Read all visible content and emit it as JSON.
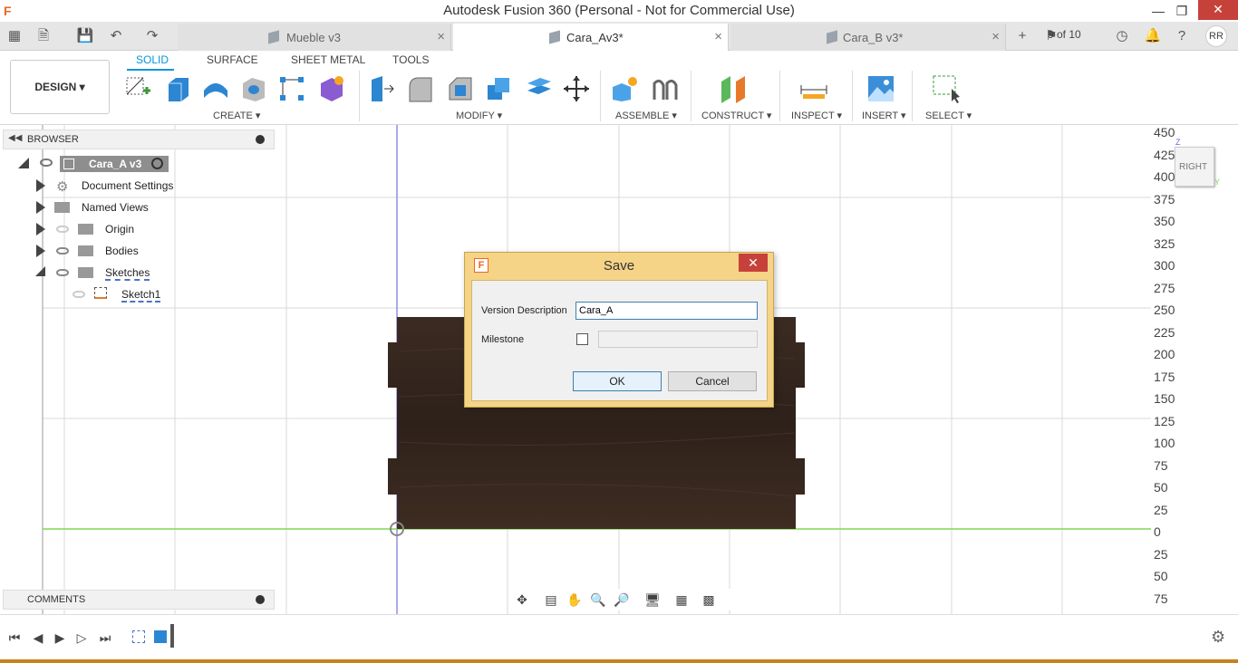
{
  "window": {
    "title": "Autodesk Fusion 360 (Personal - Not for Commercial Use)",
    "logo": "F",
    "minimize": "—",
    "maximize": "❐",
    "close": "✕"
  },
  "tabs": [
    {
      "label": "Mueble v3",
      "close": "×"
    },
    {
      "label": "Cara_Av3*",
      "close": "×"
    },
    {
      "label": "Cara_B v3*",
      "close": "×"
    }
  ],
  "tab_counter": "9 of 10",
  "user_initials": "RR",
  "workspace": "DESIGN ▾",
  "ribbon_tabs": [
    "SOLID",
    "SURFACE",
    "SHEET METAL",
    "TOOLS"
  ],
  "groups": [
    "CREATE ▾",
    "MODIFY ▾",
    "ASSEMBLE ▾",
    "CONSTRUCT ▾",
    "INSPECT ▾",
    "INSERT ▾",
    "SELECT ▾"
  ],
  "browser": {
    "title": "BROWSER",
    "root": "Cara_A v3",
    "items": [
      "Document Settings",
      "Named Views",
      "Origin",
      "Bodies",
      "Sketches",
      "Sketch1"
    ]
  },
  "ruler": [
    "450",
    "425",
    "400",
    "375",
    "350",
    "325",
    "300",
    "275",
    "250",
    "225",
    "200",
    "175",
    "150",
    "125",
    "100",
    "75",
    "50",
    "25",
    "0",
    "25",
    "50",
    "75"
  ],
  "viewcube": {
    "face": "RIGHT",
    "z": "Z",
    "y": "Y"
  },
  "dialog": {
    "title": "Save",
    "close": "✕",
    "version_label": "Version Description",
    "version_value": "Cara_A",
    "milestone_label": "Milestone",
    "ok": "OK",
    "cancel": "Cancel"
  },
  "comments": "COMMENTS",
  "colors": {
    "accent": "#0696d7",
    "dialog_frame": "#f5d387",
    "close_red": "#c7413b",
    "wood": "#3a2a20",
    "axis_green": "#7ed957",
    "axis_blue": "#8f8fe0"
  }
}
